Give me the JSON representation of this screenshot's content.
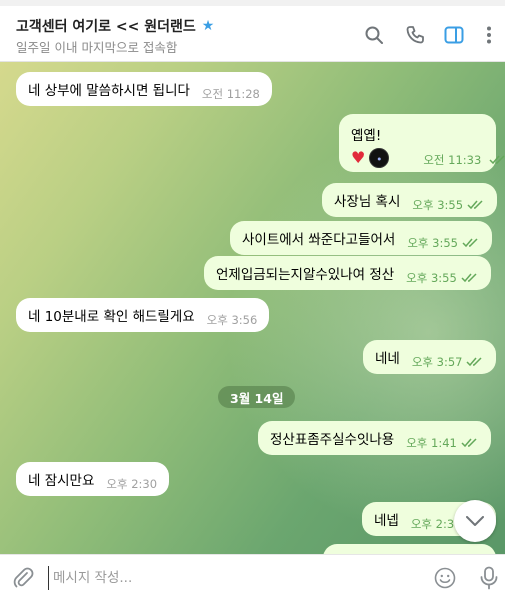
{
  "header": {
    "title": "고객센터 여기로 << 원더랜드",
    "star_icon": "star-icon",
    "status": "일주일 이내 마지막으로 접속함",
    "icons": [
      "search-icon",
      "phone-icon",
      "sidebar-toggle-icon",
      "more-icon"
    ],
    "accent_color": "#3a9ee4"
  },
  "messages": [
    {
      "dir": "in",
      "text": "네 상부에 말씀하시면 됩니다",
      "time": "오전 11:28"
    },
    {
      "dir": "out",
      "text": "옙옙!",
      "time": "오전 11:33",
      "emoji": [
        "heart-emoji",
        "round-sticker"
      ]
    },
    {
      "dir": "out",
      "text": "사장님 혹시",
      "time": "오후 3:55"
    },
    {
      "dir": "out",
      "text": "사이트에서 쏴준다고들어서",
      "time": "오후 3:55"
    },
    {
      "dir": "out",
      "text": "언제입금되는지알수있나여 정산",
      "time": "오후 3:55"
    },
    {
      "dir": "in",
      "text": "네 10분내로 확인 해드릴게요",
      "time": "오후 3:56"
    },
    {
      "dir": "out",
      "text": "네네",
      "time": "오후 3:57"
    },
    {
      "dir": "out",
      "text": "정산표좀주실수잇나용",
      "time": "오후 1:41"
    },
    {
      "dir": "in",
      "text": "네 잠시만요",
      "time": "오후 2:30"
    },
    {
      "dir": "out",
      "text": "네넵",
      "time": "오후 2:3"
    }
  ],
  "date_divider": "3월 14일",
  "composer": {
    "placeholder": "메시지 작성...",
    "icons": [
      "attach-icon",
      "emoji-icon",
      "mic-icon"
    ]
  },
  "colors": {
    "incoming_bubble": "#ffffff",
    "outgoing_bubble": "#effedd",
    "read_check": "#64a85a"
  }
}
